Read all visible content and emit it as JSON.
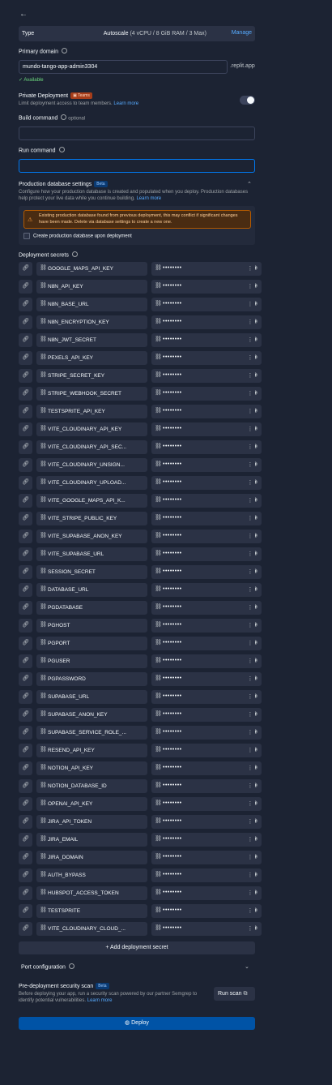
{
  "header": {
    "back_icon": "arrow-left-icon"
  },
  "machine": {
    "type_label": "Type",
    "type_value": "Autoscale",
    "type_detail": "(4 vCPU / 8 GiB RAM / 3 Max)",
    "manage_label": "Manage"
  },
  "domain": {
    "label": "Primary domain",
    "value": "mundo-tango-app-admin3304",
    "suffix": ".replit.app",
    "status": "✓ Available"
  },
  "private": {
    "label": "Private Deployment",
    "badge": "Teams",
    "description": "Limit deployment access to team members.",
    "learn_more": "Learn more"
  },
  "build": {
    "label": "Build command",
    "optional": "optional",
    "value": ""
  },
  "run": {
    "label": "Run command",
    "value": ""
  },
  "db": {
    "label": "Production database settings",
    "badge": "Beta",
    "description": "Configure how your production database is created and populated when you deploy. Production databases help protect your live data while you continue building.",
    "learn_more": "Learn more",
    "warning": "Existing production database found from previous deployment, this may conflict if significant changes have been made. Delete via database settings to create a new one.",
    "checkbox_label": "Create production database upon deployment"
  },
  "secrets": {
    "label": "Deployment secrets",
    "masked": "••••••••",
    "items": [
      "GOOGLE_MAPS_API_KEY",
      "N8N_API_KEY",
      "N8N_BASE_URL",
      "N8N_ENCRYPTION_KEY",
      "N8N_JWT_SECRET",
      "PEXELS_API_KEY",
      "STRIPE_SECRET_KEY",
      "STRIPE_WEBHOOK_SECRET",
      "TESTSPRITE_API_KEY",
      "VITE_CLOUDINARY_API_KEY",
      "VITE_CLOUDINARY_API_SEC...",
      "VITE_CLOUDINARY_UNSIGN...",
      "VITE_CLOUDINARY_UPLOAD...",
      "VITE_GOOGLE_MAPS_API_K...",
      "VITE_STRIPE_PUBLIC_KEY",
      "VITE_SUPABASE_ANON_KEY",
      "VITE_SUPABASE_URL",
      "SESSION_SECRET",
      "DATABASE_URL",
      "PGDATABASE",
      "PGHOST",
      "PGPORT",
      "PGUSER",
      "PGPASSWORD",
      "SUPABASE_URL",
      "SUPABASE_ANON_KEY",
      "SUPABASE_SERVICE_ROLE_...",
      "RESEND_API_KEY",
      "NOTION_API_KEY",
      "NOTION_DATABASE_ID",
      "OPENAI_API_KEY",
      "JIRA_API_TOKEN",
      "JIRA_EMAIL",
      "JIRA_DOMAIN",
      "AUTH_BYPASS",
      "HUBSPOT_ACCESS_TOKEN",
      "TESTSPRITE",
      "VITE_CLOUDINARY_CLOUD_..."
    ],
    "add_label": "Add deployment secret"
  },
  "port": {
    "label": "Port configuration"
  },
  "scan": {
    "label": "Pre-deployment security scan",
    "badge": "Beta",
    "description": "Before deploying your app, run a security scan powered by our partner Semgrep to identify potential vulnerabilities.",
    "learn_more": "Learn more",
    "button": "Run scan"
  },
  "deploy": {
    "label": "Deploy"
  }
}
